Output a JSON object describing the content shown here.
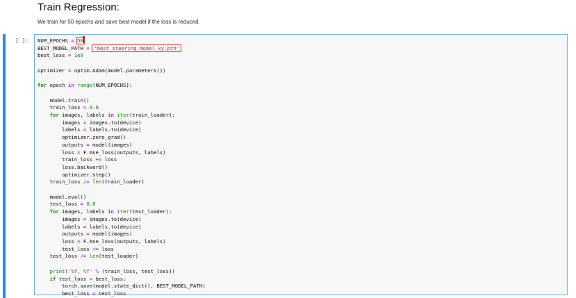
{
  "heading": "Train Regression:",
  "description": "We train for 50 epochs and save best model if the loss is reduced.",
  "cell": {
    "prompt": "[ ]:",
    "code": {
      "num_epochs_name": "NUM_EPOCHS",
      "num_epochs_value": "50",
      "best_path_name": "BEST_MODEL_PATH",
      "best_path_value": "'best_steering_model_xy.pth'",
      "best_loss_name": "best_loss",
      "best_loss_value": "1e9",
      "optimizer_line": "optim.Adam(model.parameters())",
      "for_epoch_target": "epoch",
      "range_call": "range",
      "range_arg": "(NUM_EPOCHS):",
      "train_block": {
        "train_call": "model.train()",
        "train_loss_init": "train_loss",
        "zero": "0.0",
        "for_target": "images, labels",
        "iter_arg": "(train_loader):",
        "images_to": "images.to(device)",
        "labels_to": "labels.to(device)",
        "zero_grad": "optimizer.zero_grad()",
        "outputs_line": "model(images)",
        "loss_fn": "F.mse_loss(outputs, labels)",
        "train_loss_add": "loss",
        "backward": "loss.backward()",
        "step": "optimizer.step()",
        "len_arg": "(train_loader)"
      },
      "eval_block": {
        "eval_call": "model.eval()",
        "test_loss_init": "test_loss",
        "zero": "0.0",
        "iter_arg": "(test_loader):",
        "test_loss_add": "loss",
        "len_arg": "(test_loader)"
      },
      "print_fmt": "'%f, %f'",
      "print_args": "(train_loss, test_loss))",
      "save_line": "torch.save(model.state_dict(), BEST_MODEL_PATH)",
      "best_loss_assign": "test_loss"
    }
  }
}
